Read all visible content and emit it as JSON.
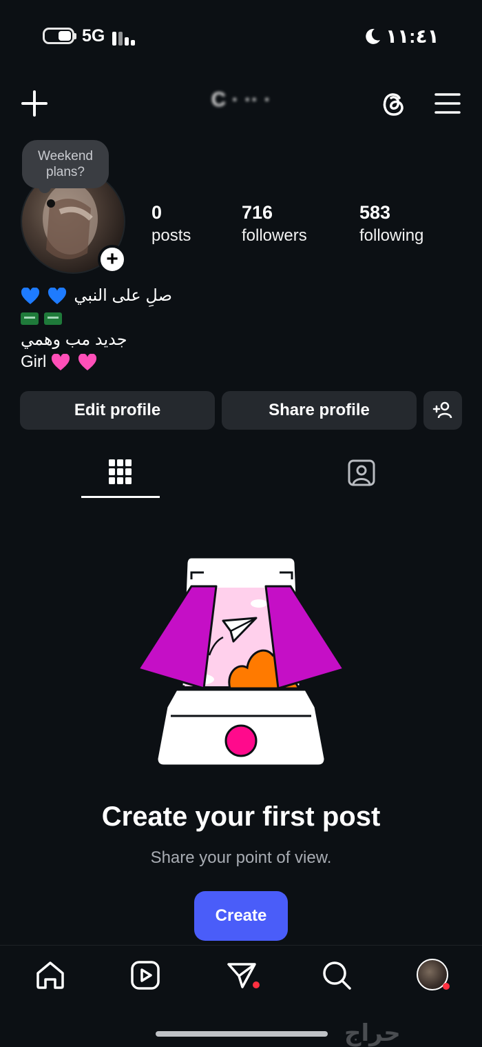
{
  "status_bar": {
    "network": "5G",
    "time": "١١:٤١"
  },
  "header": {
    "username": "C ·  ·· ·"
  },
  "note": {
    "text_line1": "Weekend",
    "text_line2": "plans?"
  },
  "stats": [
    {
      "value": "0",
      "label": "posts"
    },
    {
      "value": "716",
      "label": "followers"
    },
    {
      "value": "583",
      "label": "following"
    }
  ],
  "bio": {
    "line1": "صلِ على النبي",
    "line3": "جديد مب وهمي",
    "line4": "Girl"
  },
  "buttons": {
    "edit": "Edit profile",
    "share": "Share profile"
  },
  "empty_state": {
    "title": "Create your first post",
    "subtitle": "Share your point of view.",
    "cta": "Create"
  },
  "watermark": "حراج",
  "colors": {
    "background": "#0c1014",
    "button": "#25292e",
    "accent": "#4a5df9",
    "notification": "#ff3040",
    "magenta": "#c50fc6",
    "orange": "#ff7a00"
  },
  "icons": [
    "plus-icon",
    "threads-icon",
    "menu-icon",
    "add-person-icon",
    "grid-icon",
    "tagged-icon",
    "home-icon",
    "reels-icon",
    "send-icon",
    "search-icon",
    "moon-icon"
  ]
}
